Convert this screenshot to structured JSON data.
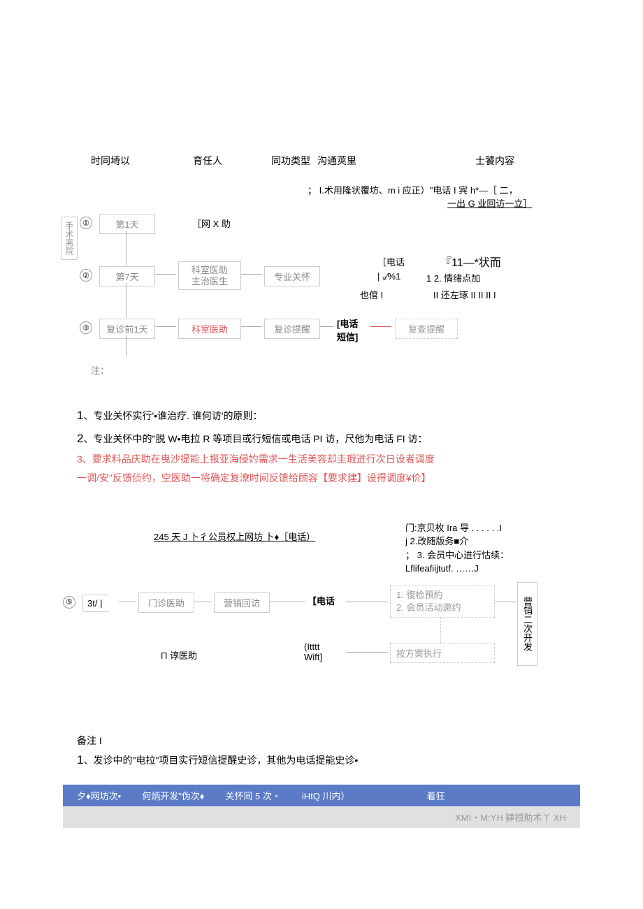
{
  "headers": {
    "col1": "时同埼以",
    "col2": "育任人",
    "col3": "同功类型",
    "col4": "沟通莢里",
    "col5": "士饕内容"
  },
  "diagram1": {
    "vlabel": "手术离院",
    "step1": {
      "num": "①",
      "day": "第1天",
      "resp": "［网 X 助",
      "right1": "；  I.术用隆状覆坊、m i 应正）\"电话 I 宾 h*—［ 二，",
      "right2": "一出 G 业回访一立］"
    },
    "step2": {
      "num": "②",
      "day": "第7天",
      "resp1": "科室医助",
      "resp2": "主治医生",
      "type": "专业关怀",
      "r1": "［电话",
      "r2": "『11—*状而",
      "r3": "| ₀⁄%1",
      "r4": "1 2. 情绪点加",
      "r5": "也倌 I",
      "r6": "II  还左琢 II II II I"
    },
    "step3": {
      "num": "③",
      "day": "复诊前1天",
      "resp": "科室医助",
      "type": "复诊提醒",
      "comm": "[电话",
      "comm2": "短信]",
      "reminder": "复查提醒"
    },
    "note_label": "注："
  },
  "notes": {
    "n1_num": "1",
    "n1_text": "、专业关怀实行'•谁治疗. 谁何访'的原则：",
    "n2_num": "2",
    "n2_text": "、专业关怀中的\"脱 W•电拉 R 等项目或行短信或电话 PI 访，尺他为电话 FI 访：",
    "n3": "3、要求料品庆助在曳沙提能上报亚海侵妁需求一生活美容却圭瑕迸行次日设者调度",
    "n4": "一调/安\"反馈侦约，空医助一将确定复潦时间反馈给顾容【要求建】设得调度¥价】"
  },
  "diagram2": {
    "title_pre": "245 天 J 卜彳公员权上网坊  卜",
    "title_suf": "♦［电话）",
    "r1": "门:京贝枚 Ira 导 . . . . . .I",
    "r2": "j 2.改随版务■介",
    "r3": "；  3. 会员中心进行怙续：",
    "r4": "Lflifeafiijtutf. ……J",
    "step5": {
      "num": "⑤",
      "label": "3t/ |",
      "resp": "门诊医助",
      "type": "营销回访",
      "comm": "【电话"
    },
    "detail1": "1. 復检預約",
    "detail2": "2. 会员活动邀约",
    "vbox": "营销二次开发",
    "lower_resp": "П 谆医助",
    "lower_comm": "(Itttt",
    "lower_comm2": "Wift]",
    "lower_detail": "按方案执行"
  },
  "footer_notes": {
    "label": "备注 I",
    "n1_num": "1",
    "n1_text": "、发诊中的\"电拉\"项目实行短信提醒史诊，其他为电话提能史诊•"
  },
  "bluebar": {
    "c1": "夕♦网坊次•",
    "c2": "何炳开发\"伪次♦",
    "c3": "关怀同 5 次・",
    "c4": "iHtQ 川内）",
    "c5": "着狂"
  },
  "graybar": "XMI・M:YH 肄根助术丫 XH"
}
